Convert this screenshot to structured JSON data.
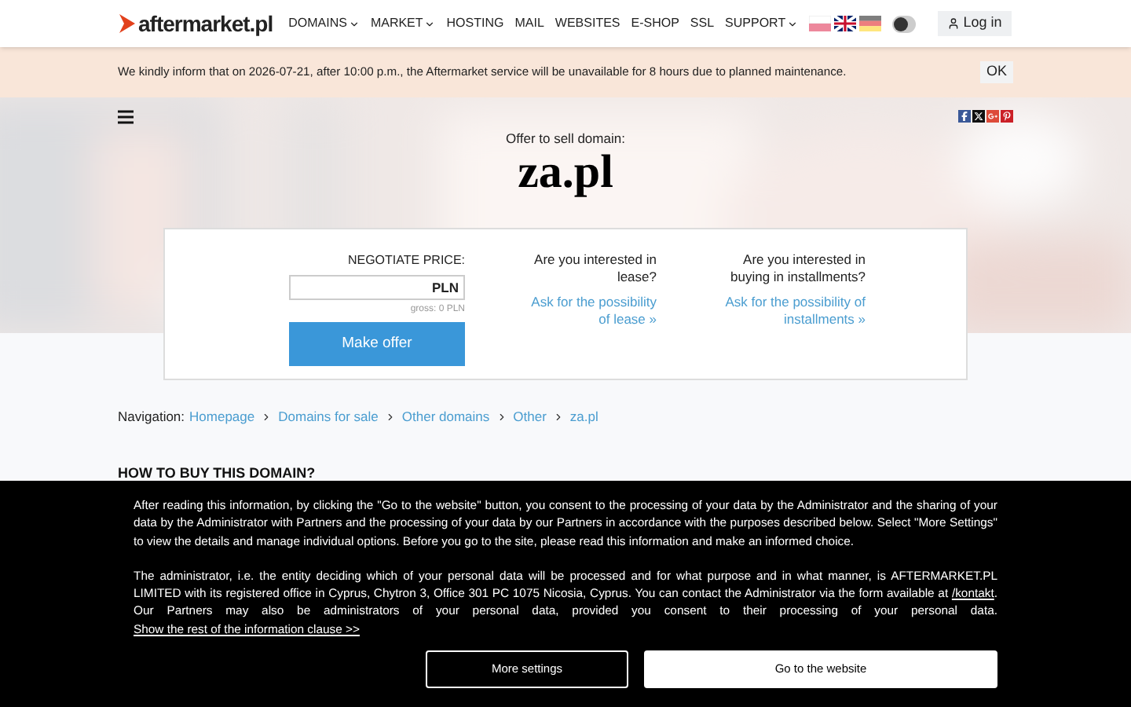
{
  "header": {
    "logo": "aftermarket.pl",
    "nav": [
      {
        "label": "DOMAINS",
        "has_menu": true
      },
      {
        "label": "MARKET",
        "has_menu": true
      },
      {
        "label": "HOSTING",
        "has_menu": false
      },
      {
        "label": "MAIL",
        "has_menu": false
      },
      {
        "label": "WEBSITES",
        "has_menu": false
      },
      {
        "label": "E-SHOP",
        "has_menu": false
      },
      {
        "label": "SSL",
        "has_menu": false
      },
      {
        "label": "SUPPORT",
        "has_menu": true
      }
    ],
    "languages": [
      {
        "kind": "pl",
        "selected": false
      },
      {
        "kind": "en",
        "selected": true
      },
      {
        "kind": "de",
        "selected": false
      }
    ],
    "dark_mode_toggle": {
      "on": false
    },
    "login": "Log in"
  },
  "notice": {
    "text": "We kindly inform that on 2026-07-21, after 10:00 p.m., the Aftermarket service will be unavailable for 8 hours due to planned maintenance.",
    "button": "OK"
  },
  "hero": {
    "subtitle": "Offer to sell domain:",
    "domain": "za.pl"
  },
  "offer": {
    "price_label": "NEGOTIATE PRICE:",
    "currency": "PLN",
    "gross": "gross: 0 PLN",
    "button": "Make offer",
    "options": [
      {
        "question": "Are you interested in lease?",
        "link": "Ask for the possibility of lease »"
      },
      {
        "question": "Are you interested in buying in installments?",
        "link": "Ask for the possibility of installments »"
      }
    ]
  },
  "breadcrumbs": {
    "label": "Navigation:",
    "items": [
      "Homepage",
      "Domains for sale",
      "Other domains",
      "Other",
      "za.pl"
    ]
  },
  "section_heading": "HOW TO BUY THIS DOMAIN?",
  "cookie_banner": {
    "paragraph_1": "After reading this information, by clicking the \"Go to the website\" button, you consent to the processing of your data by the Administrator and the sharing of your data by the Administrator with Partners and the processing of your data by our Partners in accordance with the purposes described below. Select \"More Settings\" to view the details and manage individual options. Before you go to the site, please read this information and make an informed choice.",
    "paragraph_2_start": "The administrator, i.e. the entity deciding which of your personal data will be processed and for what purpose and in what manner, is AFTERMARKET.PL LIMITED with its registered office in Cyprus, Chytron 3, Office 301 PC 1075 Nicosia, Cyprus. You can contact the Administrator via the form available at",
    "contact_link": "/kontakt",
    "paragraph_2_end": ". Our Partners may also be administrators of your personal data, provided you consent to their processing of your personal data.",
    "more_link": "Show the rest of the information clause >>",
    "buttons": [
      "More settings",
      "Go to the website"
    ]
  }
}
